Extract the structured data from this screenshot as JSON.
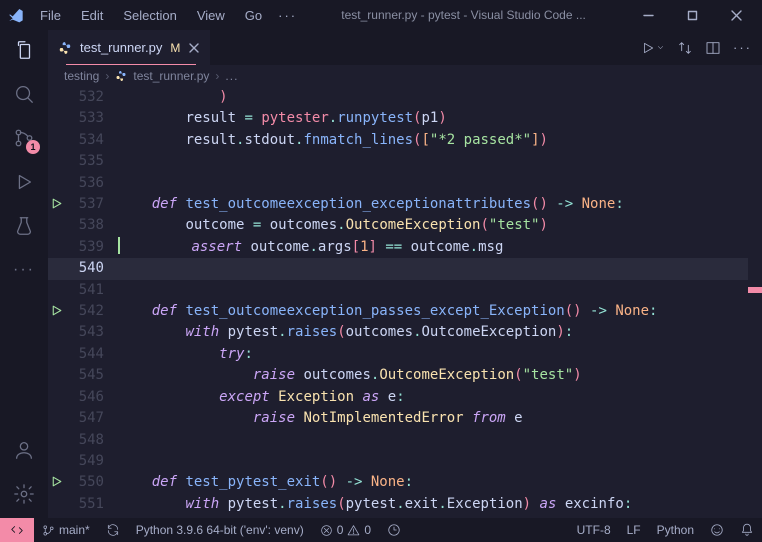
{
  "window": {
    "title": "test_runner.py - pytest - Visual Studio Code ..."
  },
  "menu": {
    "items": [
      "File",
      "Edit",
      "Selection",
      "View",
      "Go"
    ],
    "overflow": "···"
  },
  "activity": {
    "scm_badge": "1"
  },
  "tab": {
    "filename": "test_runner.py",
    "modified": "M"
  },
  "breadcrumbs": {
    "folder": "testing",
    "file": "test_runner.py",
    "ellipsis": "..."
  },
  "code": {
    "lines": [
      {
        "n": 532,
        "tokens": [
          {
            "c": "par",
            "t": ")"
          }
        ],
        "indent": 12
      },
      {
        "n": 533,
        "tokens": [
          {
            "c": "var",
            "t": "result "
          },
          {
            "c": "op",
            "t": "= "
          },
          {
            "c": "par",
            "t": "pytester"
          },
          {
            "c": "op",
            "t": "."
          },
          {
            "c": "fn",
            "t": "runpytest"
          },
          {
            "c": "par",
            "t": "("
          },
          {
            "c": "var",
            "t": "p1"
          },
          {
            "c": "par",
            "t": ")"
          }
        ],
        "indent": 8
      },
      {
        "n": 534,
        "tokens": [
          {
            "c": "var",
            "t": "result"
          },
          {
            "c": "op",
            "t": "."
          },
          {
            "c": "var",
            "t": "stdout"
          },
          {
            "c": "op",
            "t": "."
          },
          {
            "c": "fn",
            "t": "fnmatch_lines"
          },
          {
            "c": "par",
            "t": "("
          },
          {
            "c": "par2",
            "t": "["
          },
          {
            "c": "str",
            "t": "\"*2 passed*\""
          },
          {
            "c": "par2",
            "t": "]"
          },
          {
            "c": "par",
            "t": ")"
          }
        ],
        "indent": 8
      },
      {
        "n": 535,
        "tokens": [],
        "indent": 0
      },
      {
        "n": 536,
        "tokens": [],
        "indent": 0
      },
      {
        "n": 537,
        "run": true,
        "tokens": [
          {
            "c": "kw",
            "t": "def "
          },
          {
            "c": "fnD",
            "t": "test_outcomeexception_exceptionattributes"
          },
          {
            "c": "par",
            "t": "()"
          },
          {
            "c": "op",
            "t": " -> "
          },
          {
            "c": "const",
            "t": "None"
          },
          {
            "c": "op",
            "t": ":"
          }
        ],
        "indent": 4
      },
      {
        "n": 538,
        "tokens": [
          {
            "c": "var",
            "t": "outcome "
          },
          {
            "c": "op",
            "t": "= "
          },
          {
            "c": "var",
            "t": "outcomes"
          },
          {
            "c": "op",
            "t": "."
          },
          {
            "c": "cls",
            "t": "OutcomeException"
          },
          {
            "c": "par",
            "t": "("
          },
          {
            "c": "str",
            "t": "\"test\""
          },
          {
            "c": "par",
            "t": ")"
          }
        ],
        "indent": 8
      },
      {
        "n": 539,
        "cursor": true,
        "tokens": [
          {
            "c": "kw",
            "t": "assert "
          },
          {
            "c": "var",
            "t": "outcome"
          },
          {
            "c": "op",
            "t": "."
          },
          {
            "c": "var",
            "t": "args"
          },
          {
            "c": "par",
            "t": "["
          },
          {
            "c": "num",
            "t": "1"
          },
          {
            "c": "par",
            "t": "]"
          },
          {
            "c": "op",
            "t": " == "
          },
          {
            "c": "var",
            "t": "outcome"
          },
          {
            "c": "op",
            "t": "."
          },
          {
            "c": "var",
            "t": "msg"
          }
        ],
        "indent": 8
      },
      {
        "n": 540,
        "current": true,
        "tokens": [],
        "indent": 0
      },
      {
        "n": 541,
        "tokens": [],
        "indent": 0
      },
      {
        "n": 542,
        "run": true,
        "tokens": [
          {
            "c": "kw",
            "t": "def "
          },
          {
            "c": "fnD",
            "t": "test_outcomeexception_passes_except_Exception"
          },
          {
            "c": "par",
            "t": "()"
          },
          {
            "c": "op",
            "t": " -> "
          },
          {
            "c": "const",
            "t": "None"
          },
          {
            "c": "op",
            "t": ":"
          }
        ],
        "indent": 4
      },
      {
        "n": 543,
        "tokens": [
          {
            "c": "kw",
            "t": "with "
          },
          {
            "c": "var",
            "t": "pytest"
          },
          {
            "c": "op",
            "t": "."
          },
          {
            "c": "fn",
            "t": "raises"
          },
          {
            "c": "par",
            "t": "("
          },
          {
            "c": "var",
            "t": "outcomes"
          },
          {
            "c": "op",
            "t": "."
          },
          {
            "c": "var",
            "t": "OutcomeException"
          },
          {
            "c": "par",
            "t": ")"
          },
          {
            "c": "op",
            "t": ":"
          }
        ],
        "indent": 8
      },
      {
        "n": 544,
        "tokens": [
          {
            "c": "kw",
            "t": "try"
          },
          {
            "c": "op",
            "t": ":"
          }
        ],
        "indent": 12
      },
      {
        "n": 545,
        "tokens": [
          {
            "c": "kw",
            "t": "raise "
          },
          {
            "c": "var",
            "t": "outcomes"
          },
          {
            "c": "op",
            "t": "."
          },
          {
            "c": "cls",
            "t": "OutcomeException"
          },
          {
            "c": "par",
            "t": "("
          },
          {
            "c": "str",
            "t": "\"test\""
          },
          {
            "c": "par",
            "t": ")"
          }
        ],
        "indent": 16
      },
      {
        "n": 546,
        "tokens": [
          {
            "c": "kw",
            "t": "except "
          },
          {
            "c": "cls",
            "t": "Exception"
          },
          {
            "c": "kw",
            "t": " as "
          },
          {
            "c": "var",
            "t": "e"
          },
          {
            "c": "op",
            "t": ":"
          }
        ],
        "indent": 12
      },
      {
        "n": 547,
        "tokens": [
          {
            "c": "kw",
            "t": "raise "
          },
          {
            "c": "cls",
            "t": "NotImplementedError"
          },
          {
            "c": "kw",
            "t": " from "
          },
          {
            "c": "var",
            "t": "e"
          }
        ],
        "indent": 16
      },
      {
        "n": 548,
        "tokens": [],
        "indent": 0
      },
      {
        "n": 549,
        "tokens": [],
        "indent": 0
      },
      {
        "n": 550,
        "run": true,
        "tokens": [
          {
            "c": "kw",
            "t": "def "
          },
          {
            "c": "fnD",
            "t": "test_pytest_exit"
          },
          {
            "c": "par",
            "t": "()"
          },
          {
            "c": "op",
            "t": " -> "
          },
          {
            "c": "const",
            "t": "None"
          },
          {
            "c": "op",
            "t": ":"
          }
        ],
        "indent": 4
      },
      {
        "n": 551,
        "tokens": [
          {
            "c": "kw",
            "t": "with "
          },
          {
            "c": "var",
            "t": "pytest"
          },
          {
            "c": "op",
            "t": "."
          },
          {
            "c": "fn",
            "t": "raises"
          },
          {
            "c": "par",
            "t": "("
          },
          {
            "c": "var",
            "t": "pytest"
          },
          {
            "c": "op",
            "t": "."
          },
          {
            "c": "var",
            "t": "exit"
          },
          {
            "c": "op",
            "t": "."
          },
          {
            "c": "var",
            "t": "Exception"
          },
          {
            "c": "par",
            "t": ")"
          },
          {
            "c": "kw",
            "t": " as "
          },
          {
            "c": "var",
            "t": "excinfo"
          },
          {
            "c": "op",
            "t": ":"
          }
        ],
        "indent": 8
      }
    ]
  },
  "status": {
    "branch": "main*",
    "interpreter": "Python 3.9.6 64-bit ('env': venv)",
    "errors": "0",
    "warnings": "0",
    "encoding": "UTF-8",
    "eol": "LF",
    "language": "Python"
  }
}
